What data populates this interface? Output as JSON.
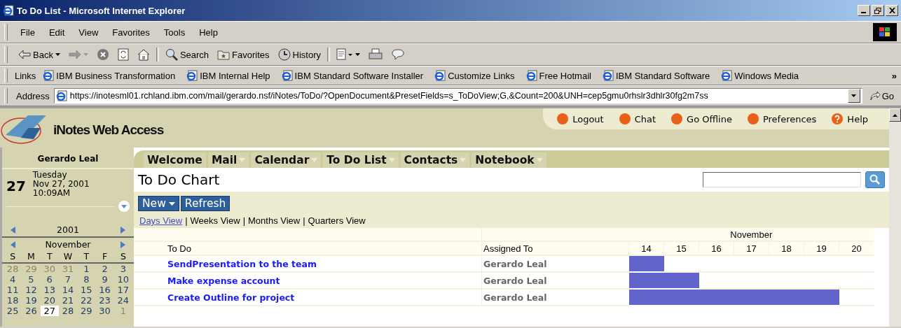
{
  "window": {
    "title": "To Do List - Microsoft Internet Explorer"
  },
  "menu": [
    "File",
    "Edit",
    "View",
    "Favorites",
    "Tools",
    "Help"
  ],
  "toolbar": [
    {
      "kind": "back",
      "label": "Back"
    },
    {
      "kind": "forward"
    },
    {
      "kind": "stop"
    },
    {
      "kind": "refresh"
    },
    {
      "kind": "home"
    },
    {
      "kind": "search",
      "label": "Search"
    },
    {
      "kind": "favorites",
      "label": "Favorites"
    },
    {
      "kind": "history",
      "label": "History"
    },
    {
      "kind": "edit"
    },
    {
      "kind": "print"
    },
    {
      "kind": "discuss"
    }
  ],
  "links": {
    "label": "Links",
    "items": [
      "IBM Business Transformation",
      "IBM Internal Help",
      "IBM Standard Software Installer",
      "Customize Links",
      "Free Hotmail",
      "IBM Standard Software",
      "Windows Media"
    ],
    "more": "»"
  },
  "address": {
    "label": "Address",
    "value": "https://inotesml01.rchland.ibm.com/mail/gerardo.nsf/iNotes/ToDo/?OpenDocument&PresetFields=s_ToDoView;G,&Count=200&UNH=cep5gmu0rhslr3dhlr30fg2m7ss",
    "go": "Go"
  },
  "app": {
    "logo": "iNotes Web Access",
    "top_links": [
      {
        "kind": "dot",
        "label": "Logout"
      },
      {
        "kind": "dot",
        "label": "Chat"
      },
      {
        "kind": "dot",
        "label": "Go Offline"
      },
      {
        "kind": "dot",
        "label": "Preferences"
      },
      {
        "kind": "help",
        "label": "Help"
      }
    ],
    "user": "Gerardo Leal",
    "today": {
      "day": "27",
      "weekday": "Tuesday",
      "date": "Nov 27, 2001",
      "time": "10:09AM"
    },
    "year": "2001",
    "month": "November",
    "weekdays": [
      "S",
      "M",
      "T",
      "W",
      "T",
      "F",
      "S"
    ],
    "weeks": [
      [
        {
          "label": "28",
          "other_month": true,
          "selected": false
        },
        {
          "label": "29",
          "other_month": true,
          "selected": false
        },
        {
          "label": "30",
          "other_month": true,
          "selected": false
        },
        {
          "label": "31",
          "other_month": true,
          "selected": false
        },
        {
          "label": "1",
          "other_month": false,
          "selected": false
        },
        {
          "label": "2",
          "other_month": false,
          "selected": false
        },
        {
          "label": "3",
          "other_month": false,
          "selected": false
        }
      ],
      [
        {
          "label": "4",
          "other_month": false,
          "selected": false
        },
        {
          "label": "5",
          "other_month": false,
          "selected": false
        },
        {
          "label": "6",
          "other_month": false,
          "selected": false
        },
        {
          "label": "7",
          "other_month": false,
          "selected": false
        },
        {
          "label": "8",
          "other_month": false,
          "selected": false
        },
        {
          "label": "9",
          "other_month": false,
          "selected": false
        },
        {
          "label": "10",
          "other_month": false,
          "selected": false
        }
      ],
      [
        {
          "label": "11",
          "other_month": false,
          "selected": false
        },
        {
          "label": "12",
          "other_month": false,
          "selected": false
        },
        {
          "label": "13",
          "other_month": false,
          "selected": false
        },
        {
          "label": "14",
          "other_month": false,
          "selected": false
        },
        {
          "label": "15",
          "other_month": false,
          "selected": false
        },
        {
          "label": "16",
          "other_month": false,
          "selected": false
        },
        {
          "label": "17",
          "other_month": false,
          "selected": false
        }
      ],
      [
        {
          "label": "18",
          "other_month": false,
          "selected": false
        },
        {
          "label": "19",
          "other_month": false,
          "selected": false
        },
        {
          "label": "20",
          "other_month": false,
          "selected": false
        },
        {
          "label": "21",
          "other_month": false,
          "selected": false
        },
        {
          "label": "22",
          "other_month": false,
          "selected": false
        },
        {
          "label": "23",
          "other_month": false,
          "selected": false
        },
        {
          "label": "24",
          "other_month": false,
          "selected": false
        }
      ],
      [
        {
          "label": "25",
          "other_month": false,
          "selected": false
        },
        {
          "label": "26",
          "other_month": false,
          "selected": false
        },
        {
          "label": "27",
          "other_month": false,
          "selected": true
        },
        {
          "label": "28",
          "other_month": false,
          "selected": false
        },
        {
          "label": "29",
          "other_month": false,
          "selected": false
        },
        {
          "label": "30",
          "other_month": false,
          "selected": false
        },
        {
          "label": "1",
          "other_month": true,
          "selected": false
        }
      ]
    ],
    "tabs": [
      {
        "label": "Welcome",
        "dropdown": false
      },
      {
        "label": "Mail",
        "dropdown": true
      },
      {
        "label": "Calendar",
        "dropdown": true
      },
      {
        "label": "To Do List",
        "dropdown": true
      },
      {
        "label": "Contacts",
        "dropdown": true
      },
      {
        "label": "Notebook",
        "dropdown": true
      }
    ],
    "page_title": "To Do Chart",
    "buttons": [
      {
        "label": "New",
        "dropdown": true
      },
      {
        "label": "Refresh",
        "dropdown": false
      }
    ],
    "views": [
      {
        "label": "Days View",
        "link": true
      },
      {
        "label": "Weeks View",
        "link": false
      },
      {
        "label": "Months View",
        "link": false
      },
      {
        "label": "Quarters View",
        "link": false
      }
    ],
    "views_separator": "|",
    "table": {
      "columns": [
        "To Do",
        "Assigned To"
      ],
      "month": "November",
      "days": [
        "14",
        "15",
        "16",
        "17",
        "18",
        "19",
        "20"
      ],
      "rows": [
        {
          "task": "SendPresentation to the team",
          "assigned": "Gerardo Leal",
          "filled": [
            true,
            false,
            false,
            false,
            false,
            false,
            false
          ]
        },
        {
          "task": "Make expense account",
          "assigned": "Gerardo Leal",
          "filled": [
            true,
            true,
            false,
            false,
            false,
            false,
            false
          ]
        },
        {
          "task": "Create Outline for project",
          "assigned": "Gerardo Leal",
          "filled": [
            true,
            true,
            true,
            true,
            true,
            true,
            false
          ]
        }
      ]
    }
  }
}
